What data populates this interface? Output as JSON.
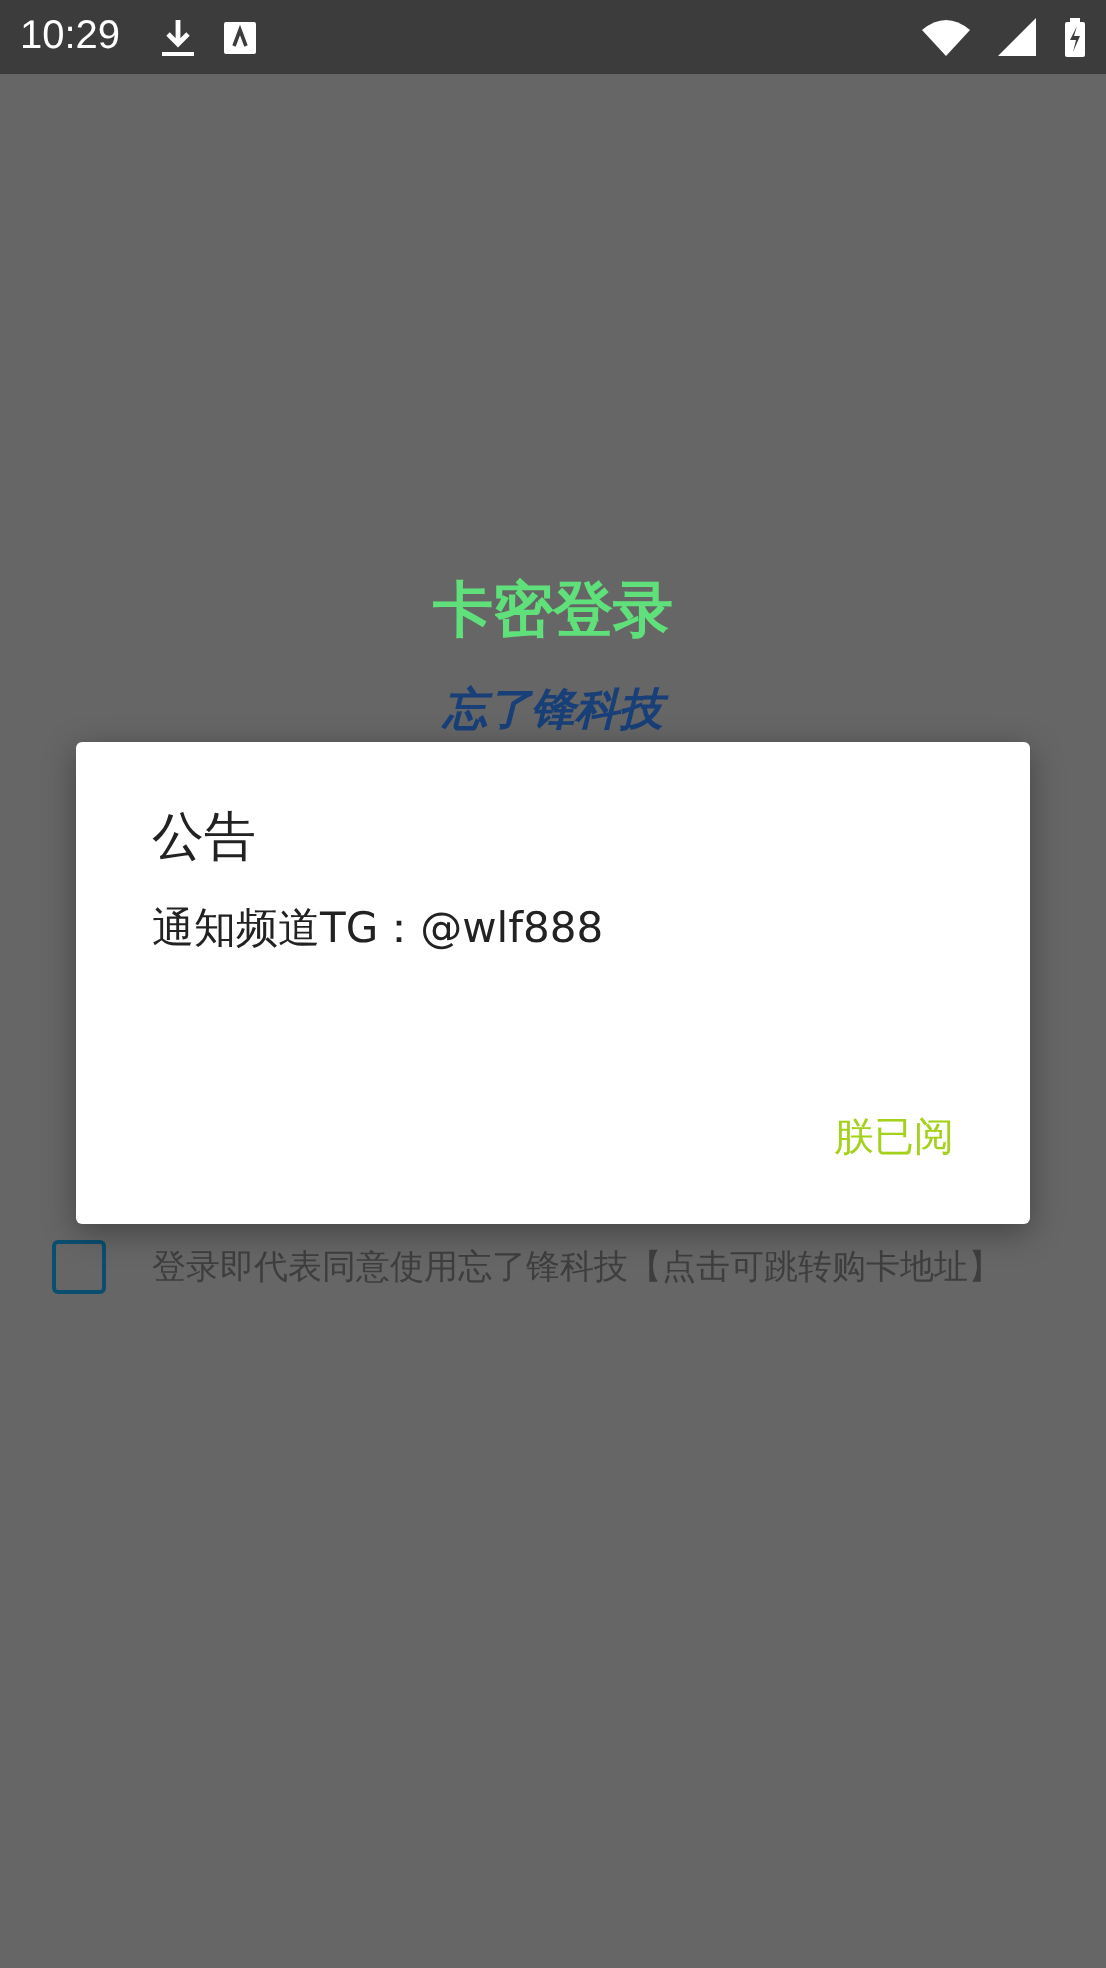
{
  "status_bar": {
    "time": "10:29"
  },
  "login": {
    "title": "卡密登录",
    "subtitle": "忘了锋科技"
  },
  "agreement": {
    "checked": false,
    "label": "登录即代表同意使用忘了锋科技【点击可跳转购卡地址】"
  },
  "dialog": {
    "title": "公告",
    "message": "通知频道TG：@wlf888",
    "button": "朕已阅"
  }
}
